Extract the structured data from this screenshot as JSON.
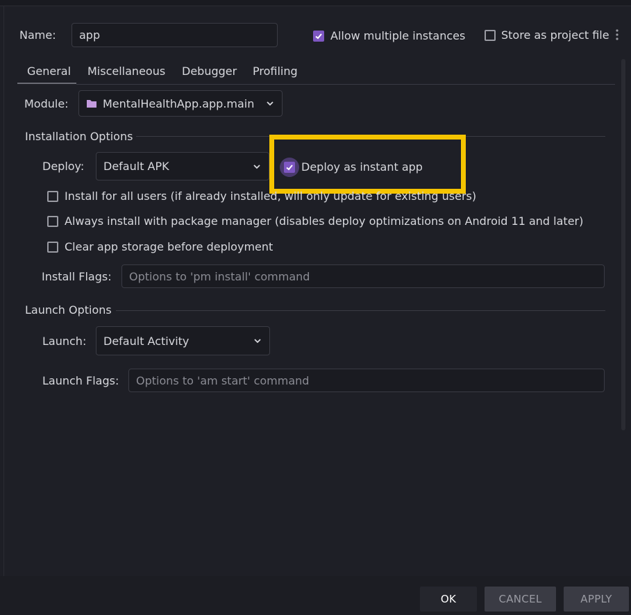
{
  "header": {
    "name_label": "Name:",
    "name_value": "app",
    "allow_multiple_label": "Allow multiple instances",
    "store_as_project_label": "Store as project file"
  },
  "tabs": [
    {
      "label": "General"
    },
    {
      "label": "Miscellaneous"
    },
    {
      "label": "Debugger"
    },
    {
      "label": "Profiling"
    }
  ],
  "module": {
    "label": "Module:",
    "value": "MentalHealthApp.app.main"
  },
  "installation": {
    "section_title": "Installation Options",
    "deploy_label": "Deploy:",
    "deploy_value": "Default APK",
    "deploy_instant_label": "Deploy as instant app",
    "install_all_users_label": "Install for all users (if already installed, will only update for existing users)",
    "always_pm_label": "Always install with package manager (disables deploy optimizations on Android 11 and later)",
    "clear_storage_label": "Clear app storage before deployment",
    "install_flags_label": "Install Flags:",
    "install_flags_placeholder": "Options to 'pm install' command"
  },
  "launch": {
    "section_title": "Launch Options",
    "launch_label": "Launch:",
    "launch_value": "Default Activity",
    "launch_flags_label": "Launch Flags:",
    "launch_flags_placeholder": "Options to 'am start' command"
  },
  "buttons": {
    "ok": "OK",
    "cancel": "CANCEL",
    "apply": "APPLY"
  },
  "colors": {
    "accent": "#7e57c2",
    "highlight": "#f5c400",
    "background": "#1e1f26"
  }
}
